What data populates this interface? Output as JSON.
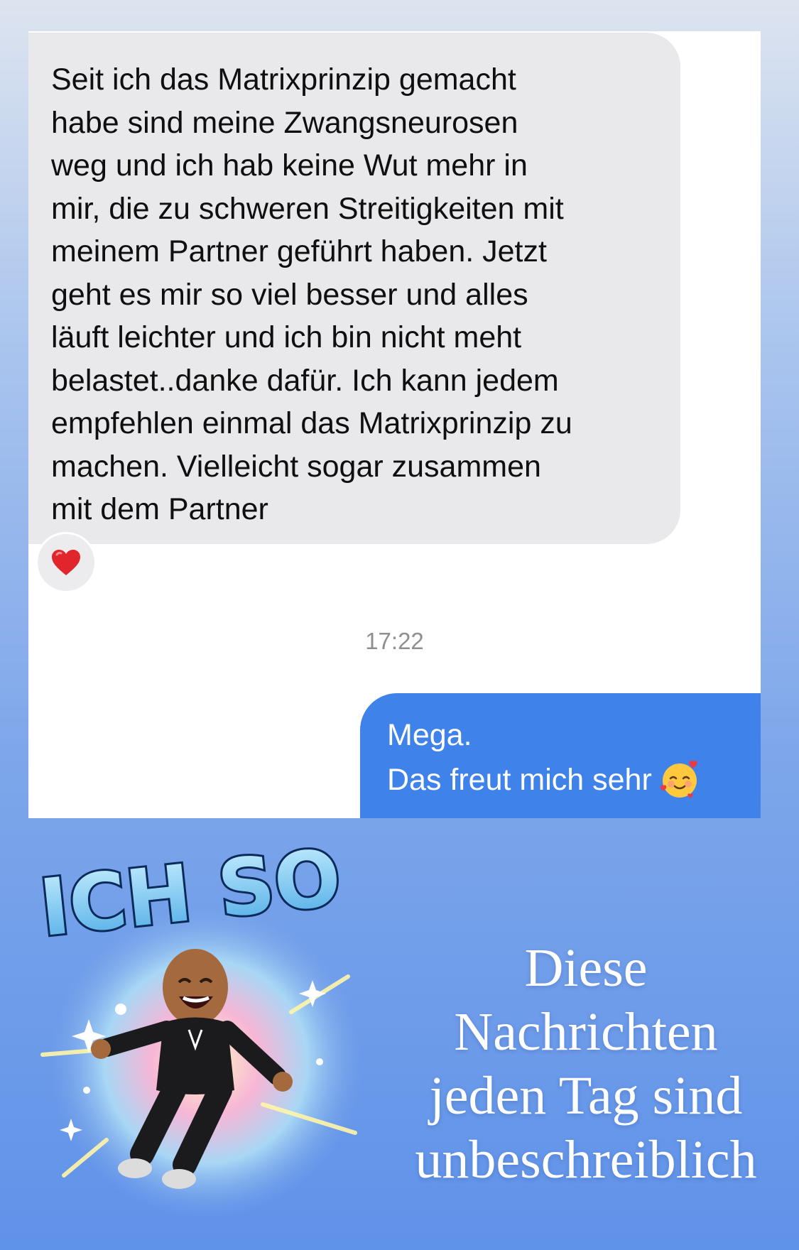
{
  "chat": {
    "incoming_message": "Seit ich das Matrixprinzip gemacht\nhabe sind meine Zwangsneurosen\nweg und ich hab keine Wut mehr in\nmir, die zu schweren Streitigkeiten mit\nmeinem Partner geführt haben. Jetzt\ngeht es mir so viel besser und alles\nläuft leichter und ich bin nicht meht\nbelastet..danke dafür. Ich kann jedem\nempfehlen einmal das Matrixprinzip zu\nmachen. Vielleicht sogar zusammen\nmit dem Partner",
    "reaction_icon": "red-heart",
    "timestamp": "17:22",
    "outgoing_message": {
      "line1": "Mega.",
      "line2": "Das freut mich sehr",
      "emoji": "smiling-face-with-hearts"
    },
    "colors": {
      "incoming_bubble": "#e9e9eb",
      "outgoing_bubble": "#3e82ea",
      "reaction_heart": "#e0262c"
    }
  },
  "sticker": {
    "title": "ICH SO",
    "description_icon": "bitmoji-jumping-character"
  },
  "caption": {
    "line1": "Diese",
    "line2": "Nachrichten",
    "line3": "jeden Tag sind",
    "line4": "unbeschreiblich"
  }
}
